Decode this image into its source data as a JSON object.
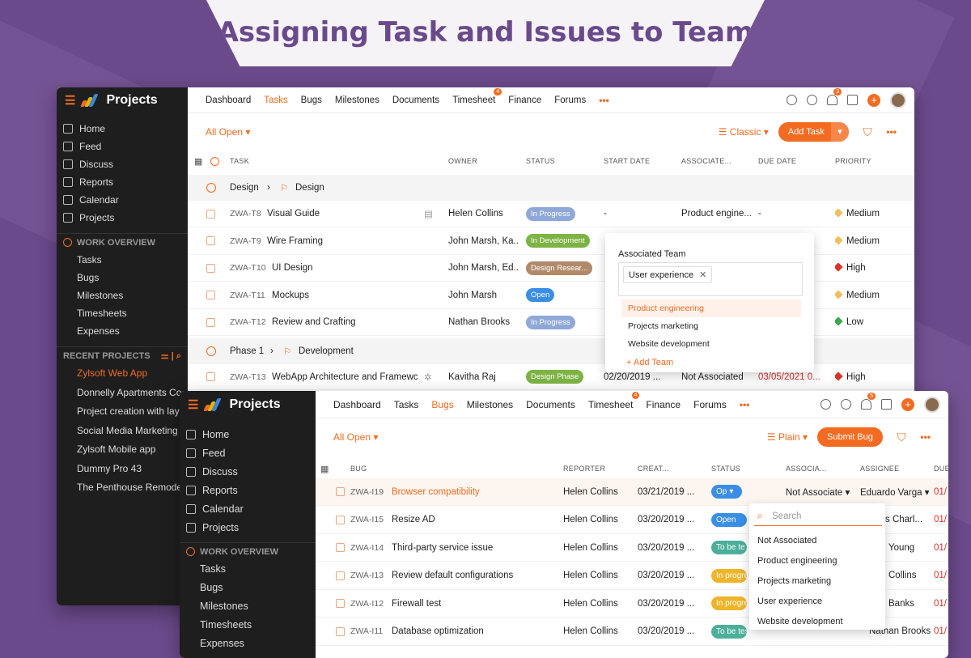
{
  "banner": {
    "title": "Assigning Task and Issues to Team"
  },
  "colors": {
    "accent": "#f26b21",
    "purple": "#6b4a8c"
  },
  "app": {
    "name": "Projects"
  },
  "win1": {
    "tabs": [
      "Dashboard",
      "Tasks",
      "Bugs",
      "Milestones",
      "Documents",
      "Timesheet",
      "Finance",
      "Forums"
    ],
    "timesheet_badge": "4",
    "notif_badge": "3",
    "nav": [
      "Home",
      "Feed",
      "Discuss",
      "Reports",
      "Calendar",
      "Projects"
    ],
    "work_overview": "WORK OVERVIEW",
    "wo_items": [
      "Tasks",
      "Bugs",
      "Milestones",
      "Timesheets",
      "Expenses"
    ],
    "recent": "RECENT PROJECTS",
    "recent_items": [
      "Zylsoft Web App",
      "Donnelly Apartments Co",
      "Project creation with lay",
      "Social Media Marketing",
      "Zylsoft Mobile app",
      "Dummy Pro 43",
      "The Penthouse Remode"
    ],
    "filter": "All Open",
    "view": "Classic",
    "add": "Add Task",
    "cols": [
      "TASK",
      "OWNER",
      "STATUS",
      "START DATE",
      "ASSOCIATE...",
      "DUE DATE",
      "PRIORITY"
    ],
    "group1": {
      "a": "Design",
      "b": "Design"
    },
    "group2": {
      "a": "Phase 1",
      "b": "Development"
    },
    "rows": [
      {
        "code": "ZWA-T8",
        "name": "Visual Guide",
        "owner": "Helen Collins",
        "status": "In Progress",
        "start": "-",
        "assoc": "Product engine...",
        "due": "-",
        "priority": "Medium"
      },
      {
        "code": "ZWA-T9",
        "name": "Wire Framing",
        "owner": "John Marsh, Ka...",
        "status": "In Development",
        "start": "",
        "assoc": "",
        "due": "",
        "priority": "Medium"
      },
      {
        "code": "ZWA-T10",
        "name": "UI Design",
        "owner": "John Marsh, Ed...",
        "status": "Design Resear...",
        "start": "",
        "assoc": "",
        "due": "",
        "priority": "High"
      },
      {
        "code": "ZWA-T11",
        "name": "Mockups",
        "owner": "John Marsh",
        "status": "Open",
        "start": "",
        "assoc": "",
        "due": "",
        "priority": "Medium"
      },
      {
        "code": "ZWA-T12",
        "name": "Review and Crafting",
        "owner": "Nathan Brooks",
        "status": "In Progress",
        "start": "",
        "assoc": "",
        "due": "",
        "priority": "Low"
      }
    ],
    "row13": {
      "code": "ZWA-T13",
      "name": "WebApp Architecture and Framewc",
      "owner": "Kavitha Raj",
      "status": "Design Phase",
      "start": "02/20/2019 ...",
      "assoc": "Not Associated",
      "due": "03/05/2021 0...",
      "priority": "High"
    },
    "popup": {
      "title": "Associated Team",
      "chip": "User experience",
      "options": [
        "Product engineering",
        "Projects marketing",
        "Website development"
      ],
      "add": "+ Add Team"
    }
  },
  "win2": {
    "tabs": [
      "Dashboard",
      "Tasks",
      "Bugs",
      "Milestones",
      "Documents",
      "Timesheet",
      "Finance",
      "Forums"
    ],
    "timesheet_badge": "4",
    "notif_badge": "5",
    "nav": [
      "Home",
      "Feed",
      "Discuss",
      "Reports",
      "Calendar",
      "Projects"
    ],
    "work_overview": "WORK OVERVIEW",
    "wo_items": [
      "Tasks",
      "Bugs",
      "Milestones",
      "Timesheets",
      "Expenses"
    ],
    "filter": "All Open",
    "view": "Plain",
    "submit": "Submit Bug",
    "cols": [
      "BUG",
      "REPORTER",
      "CREAT...",
      "STATUS",
      "ASSOCIA...",
      "ASSIGNEE",
      "DUE"
    ],
    "rows": [
      {
        "code": "ZWA-I19",
        "name": "Browser compatibility",
        "reporter": "Helen Collins",
        "created": "03/21/2019 ...",
        "status": "Op",
        "assoc": "Not Associate",
        "assignee": "Eduardo Varga",
        "due": "01/"
      },
      {
        "code": "ZWA-I15",
        "name": "Resize AD",
        "reporter": "Helen Collins",
        "created": "03/20/2019 ...",
        "status": "Open",
        "assoc": "",
        "assignee": "s Charl...",
        "due": "01/"
      },
      {
        "code": "ZWA-I14",
        "name": "Third-party service issue",
        "reporter": "Helen Collins",
        "created": "03/20/2019 ...",
        "status": "To be te",
        "assoc": "",
        "assignee": "Young",
        "due": "01/"
      },
      {
        "code": "ZWA-I13",
        "name": "Review default configurations",
        "reporter": "Helen Collins",
        "created": "03/20/2019 ...",
        "status": "In progre",
        "assoc": "",
        "assignee": "Collins",
        "due": "01/"
      },
      {
        "code": "ZWA-I12",
        "name": "Firewall test",
        "reporter": "Helen Collins",
        "created": "03/20/2019 ...",
        "status": "In progre",
        "assoc": "",
        "assignee": "Banks",
        "due": "01/"
      },
      {
        "code": "ZWA-I11",
        "name": "Database optimization",
        "reporter": "Helen Collins",
        "created": "03/20/2019 ...",
        "status": "To be tes",
        "assoc": "",
        "assignee": "Nathan Brooks",
        "due": "01/"
      }
    ],
    "dropdown": {
      "placeholder": "Search",
      "options": [
        "Not Associated",
        "Product engineering",
        "Projects marketing",
        "User experience",
        "Website development"
      ]
    }
  }
}
